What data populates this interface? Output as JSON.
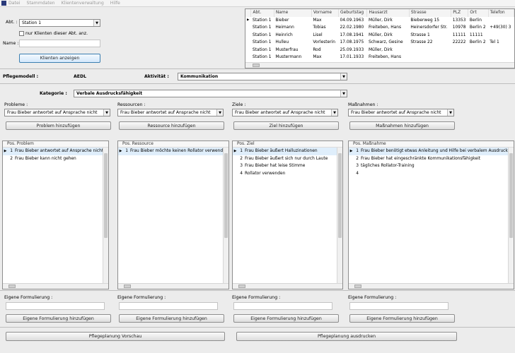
{
  "menu": [
    "Datei",
    "Stammdaten",
    "Klientenverwaltung",
    "Hilfe"
  ],
  "filter": {
    "abt_label": "Abt. :",
    "abt_value": "Station 1",
    "checkbox_label": "nur Klienten dieser Abt. anz.",
    "name_label": "Name :",
    "name_value": "",
    "show_button": "Klienten anzeigen"
  },
  "patients": {
    "columns": [
      "Abt.",
      "Name",
      "Vorname",
      "Geburtstag",
      "Hausarzt",
      "Strasse",
      "PLZ",
      "Ort",
      "Telefon"
    ],
    "rows": [
      [
        "Station 1",
        "Bieber",
        "Max",
        "04.09.1963",
        "Müller, Dirk",
        "Bieberweg 15",
        "13353",
        "Berlin",
        ""
      ],
      [
        "Station 1",
        "Heimann",
        "Tobias",
        "22.02.1980",
        "Freiteben, Hans",
        "Heinersdorfer Str.",
        "10978",
        "Berlin 2",
        "+49(30) 3"
      ],
      [
        "Station 1",
        "Heinrich",
        "Lisel",
        "17.08.1941",
        "Müller, Dirk",
        "Strasse 1",
        "11111",
        "11111",
        ""
      ],
      [
        "Station 1",
        "Hulleu",
        "Vorlesterin",
        "17.08.1975",
        "Schwarz, Gesine",
        "Strasse 22",
        "22222",
        "Berlin 2",
        "Tel 1"
      ],
      [
        "Station 1",
        "Musterfrau",
        "Rod",
        "25.09.1933",
        "Müller, Dirk",
        "",
        "",
        "",
        ""
      ],
      [
        "Station 1",
        "Mustermann",
        "Max",
        "17.01.1933",
        "Freiteben, Hans",
        "",
        "",
        "",
        ""
      ]
    ]
  },
  "model": {
    "pflegemodell_label": "Pflegemodell :",
    "pflegemodell_value": "AEDL",
    "aktivitaet_label": "Aktivität :",
    "aktivitaet_value": "Kommunikation",
    "kategorie_label": "Kategorie :",
    "kategorie_value": "Verbale Ausdrucksfähigkeit"
  },
  "columns": [
    {
      "label": "Probleme :",
      "select": "Frau Bieber antwortet auf Ansprache nicht",
      "add_button": "Problem hinzufügen",
      "list_header": "Pos. Problem",
      "items": [
        {
          "n": "1",
          "text": "Frau Bieber antwortet auf Ansprache nicht"
        },
        {
          "n": "2",
          "text": "Frau Bieber kann nicht gehen"
        }
      ],
      "custom_label": "Eigene Formulierung :",
      "custom_button": "Eigene Formulierung hinzufügen"
    },
    {
      "label": "Ressourcen :",
      "select": "Frau Bieber antwortet auf Ansprache nicht",
      "add_button": "Ressource hinzufügen",
      "list_header": "Pos. Ressource",
      "items": [
        {
          "n": "1",
          "text": "Frau Bieber möchte keinen Rollator verwenden"
        }
      ],
      "custom_label": "Eigene Formulierung :",
      "custom_button": "Eigene Formulierung hinzufügen"
    },
    {
      "label": "Ziele :",
      "select": "Frau Bieber antwortet auf Ansprache nicht",
      "add_button": "Ziel hinzufügen",
      "list_header": "Pos. Ziel",
      "items": [
        {
          "n": "1",
          "text": "Frau Bieber  äußert Halluzinationen"
        },
        {
          "n": "2",
          "text": "Frau Bieber  äußert sich nur durch Laute"
        },
        {
          "n": "3",
          "text": "Frau Bieber  hat leise Stimme"
        },
        {
          "n": "4",
          "text": "Rollator verwenden"
        }
      ],
      "custom_label": "Eigene Formulierung :",
      "custom_button": "Eigene Formulierung hinzufügen"
    },
    {
      "label": "Maßnahmen :",
      "select": "Frau Bieber antwortet auf Ansprache nicht",
      "add_button": "Maßnahmen hinzufügen",
      "list_header": "Pos. Maßnahme",
      "items": [
        {
          "n": "1",
          "text": "Frau Bieber  benötigt etwas Anleitung und Hilfe bei verbalem Ausdruck"
        },
        {
          "n": "2",
          "text": "Frau Bieber  hat eingeschränkte Kommunikationsfähigkeit"
        },
        {
          "n": "3",
          "text": "tägliches Rollator-Training"
        },
        {
          "n": "4",
          "text": ""
        }
      ],
      "custom_label": "Eigene Formulierung :",
      "custom_button": "Eigene Formulierung hinzufügen"
    }
  ],
  "footer": {
    "preview_button": "Pflegeplanung Vorschau",
    "print_button": "Pflegeplanung ausdrucken"
  }
}
